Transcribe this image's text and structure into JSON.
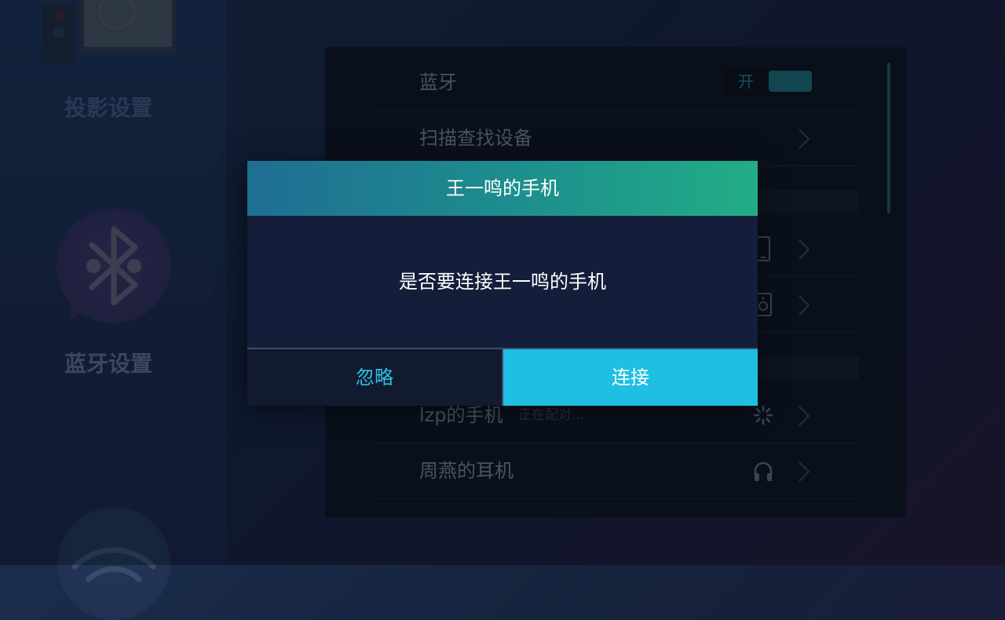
{
  "sidebar": {
    "items": [
      {
        "label": "投影设置",
        "icon": "projector-icon"
      },
      {
        "label": "蓝牙设置",
        "icon": "bluetooth-icon"
      },
      {
        "label": "",
        "icon": "wifi-icon"
      }
    ]
  },
  "settings": {
    "bluetooth": {
      "label": "蓝牙",
      "switch_text": "开"
    },
    "scan": {
      "label": "扫描查找设备"
    },
    "devices": [
      {
        "label": "lzp的手机",
        "status": "正在配对...",
        "icon": "loading-spinner-icon"
      },
      {
        "label": "周燕的耳机",
        "status": "",
        "icon": "headphones-icon"
      }
    ],
    "hidden_device_icons": [
      "phone-icon",
      "speaker-icon"
    ]
  },
  "dialog": {
    "title": "王一鸣的手机",
    "message": "是否要连接王一鸣的手机",
    "ignore_label": "忽略",
    "connect_label": "连接"
  },
  "colors": {
    "accent": "#1fbfe3",
    "header_start": "#1f6e93",
    "header_end": "#22ad86",
    "dialog_bg": "#141d39"
  }
}
